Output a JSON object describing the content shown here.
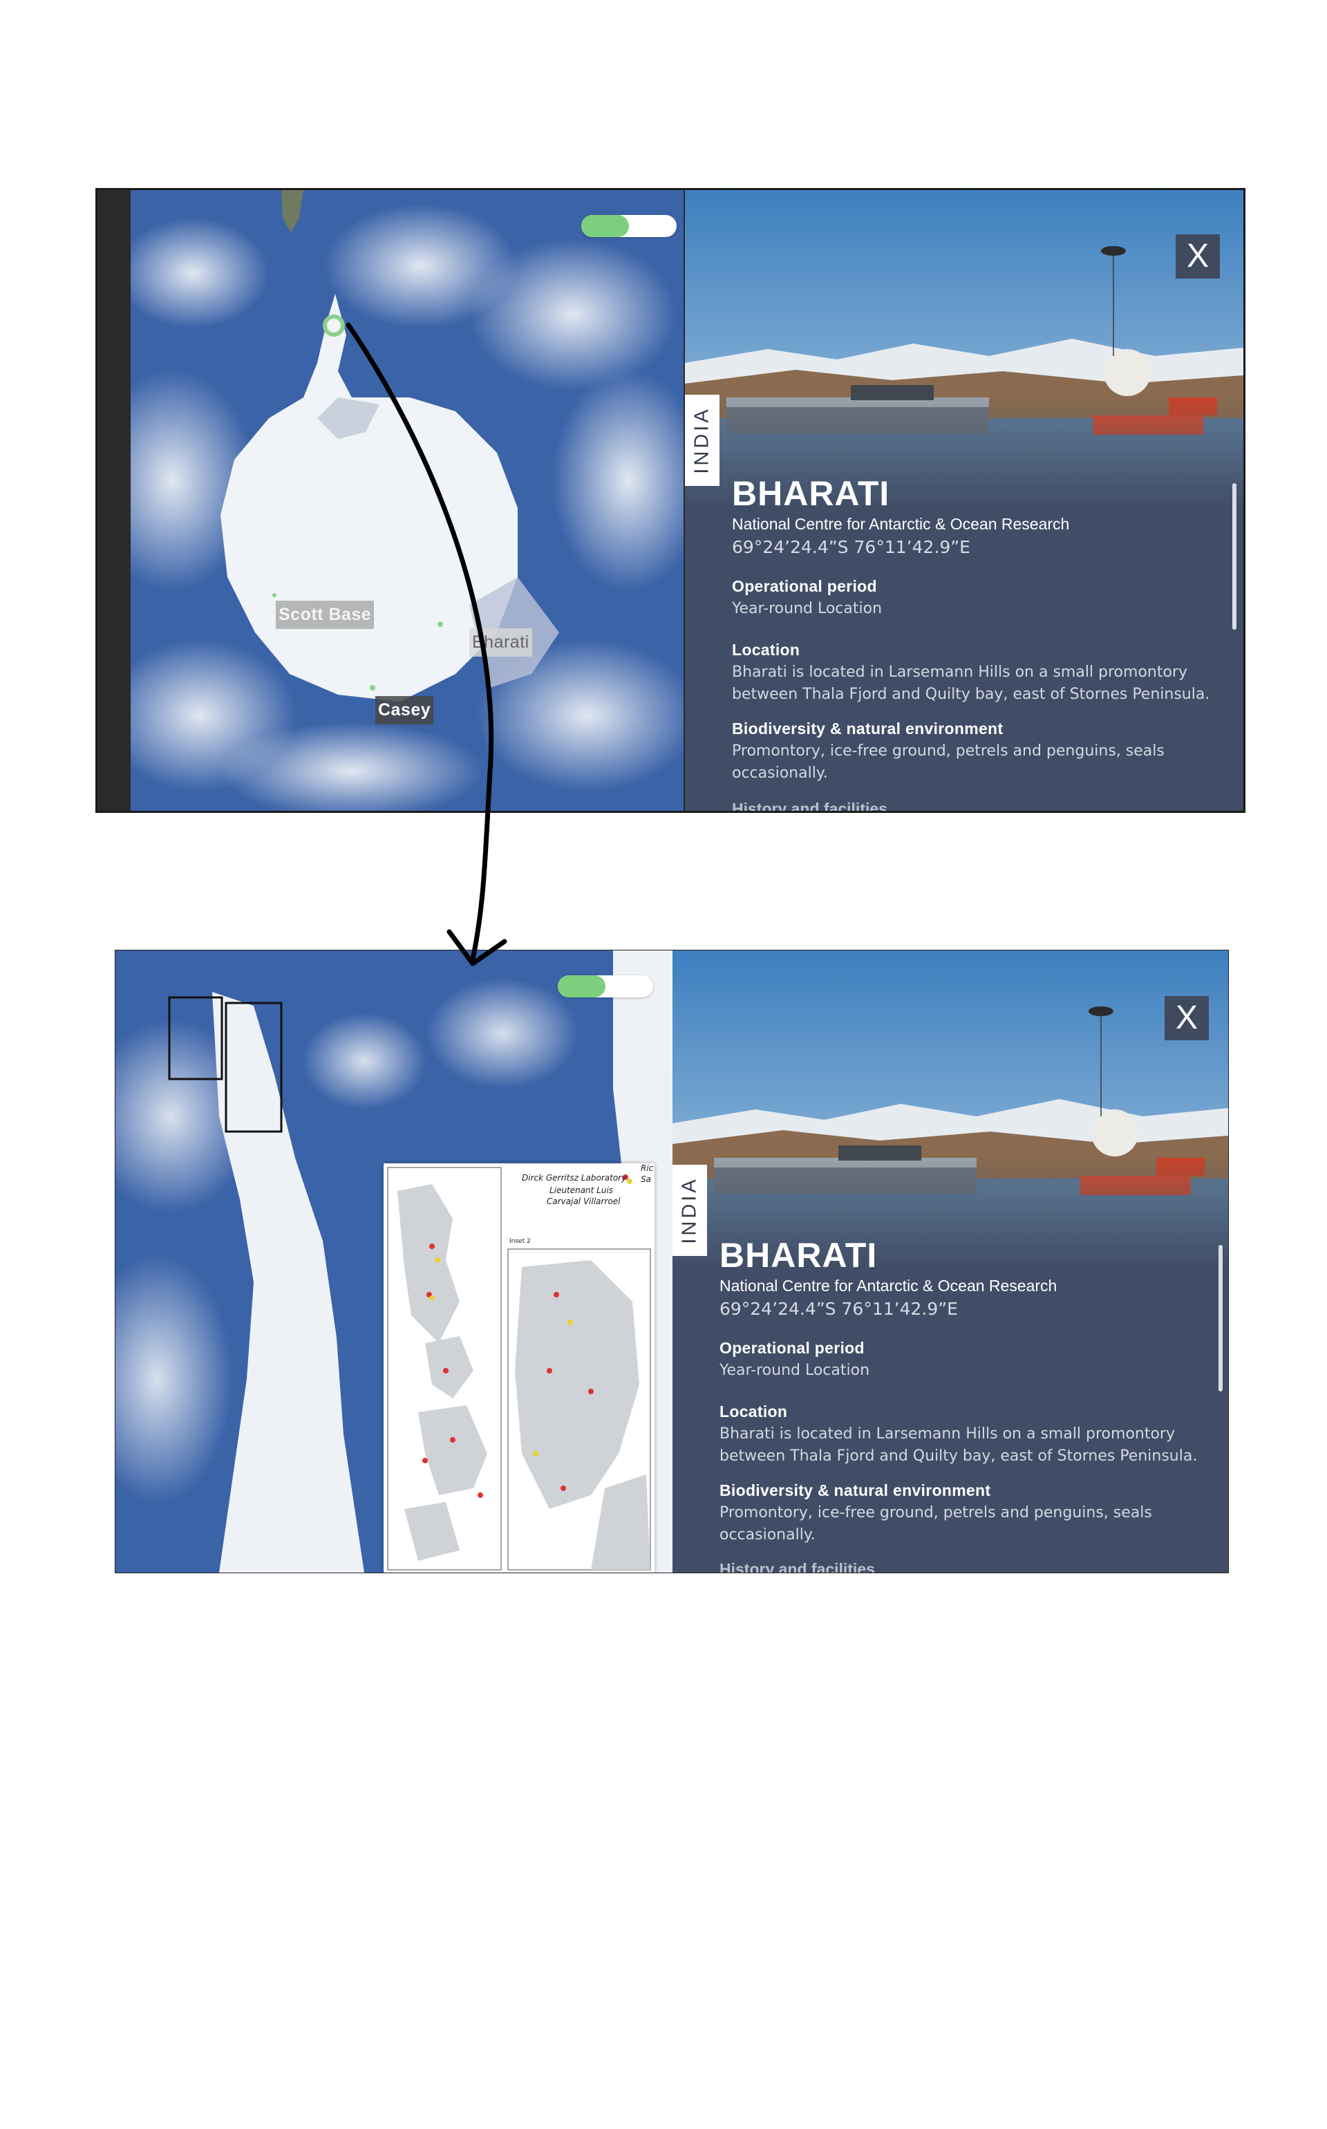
{
  "colors": {
    "panel_bg": "#414d66",
    "toggle_on": "#7ccf7c",
    "ocean": "#3b63a8",
    "ice": "#f0f3f7"
  },
  "screen_top": {
    "map": {
      "toggle_state": 0.5,
      "labels": {
        "scott_base": "Scott Base",
        "bharati": "Bharati",
        "casey": "Casey"
      }
    },
    "panel": {
      "close_label": "X",
      "country": "INDIA",
      "station_name": "BHARATI",
      "institution": "National Centre for Antarctic & Ocean Research",
      "coordinates": "69°24’24.4”S 76°11’42.9”E",
      "sections": {
        "operational_period": {
          "heading": "Operational period",
          "text": "Year-round Location"
        },
        "location": {
          "heading": "Location",
          "line1": "Bharati is located in Larsemann Hills on a small promontory",
          "line2": "between Thala Fjord and Quilty bay, east of Stornes Peninsula."
        },
        "biodiversity": {
          "heading": "Biodiversity & natural environment",
          "line1": "Promontory, ice-free ground, petrels and penguins, seals",
          "line2": "occasionally."
        },
        "history": {
          "heading": "History and facilities"
        }
      }
    }
  },
  "screen_bottom": {
    "map": {
      "toggle_state": 0.5,
      "inset": {
        "title_line1": "Dirck Gerritsz Laboratory",
        "title_line2": "Lieutenant Luis",
        "title_line3": "Carvajal Villarroel",
        "corner_top": "Ric",
        "corner_bottom": "Sa",
        "map2_label": "Inset 2"
      }
    },
    "panel": {
      "close_label": "X",
      "country": "INDIA",
      "station_name": "BHARATI",
      "institution": "National Centre for Antarctic & Ocean Research",
      "coordinates": "69°24’24.4”S 76°11’42.9”E",
      "sections": {
        "operational_period": {
          "heading": "Operational period",
          "text": "Year-round Location"
        },
        "location": {
          "heading": "Location",
          "line1": "Bharati is located in Larsemann Hills on a small promontory",
          "line2": "between Thala Fjord and Quilty bay, east of Stornes Peninsula."
        },
        "biodiversity": {
          "heading": "Biodiversity & natural environment",
          "line1": "Promontory, ice-free ground, petrels and penguins, seals",
          "line2": "occasionally."
        },
        "history": {
          "heading": "History and facilities"
        }
      }
    }
  }
}
